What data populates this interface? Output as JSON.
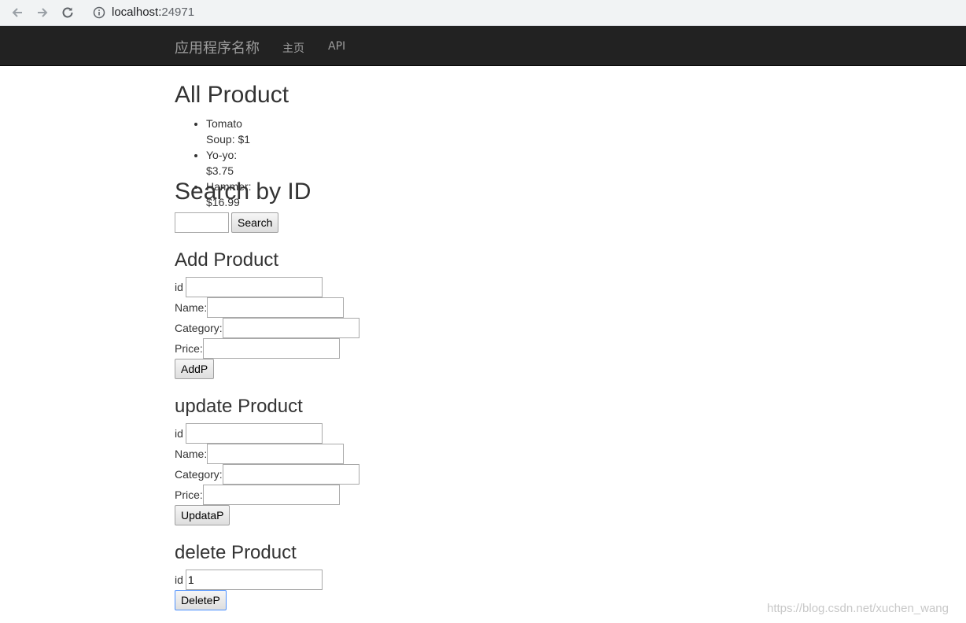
{
  "browser": {
    "url_host": "localhost:",
    "url_port": "24971"
  },
  "navbar": {
    "brand": "应用程序名称",
    "links": [
      "主页",
      "API"
    ],
    "background": "#222222"
  },
  "all_products": {
    "title": "All Product",
    "items": [
      "Tomato Soup: $1",
      "Yo-yo: $3.75",
      "Hammer: $16.99"
    ]
  },
  "search": {
    "title": "Search by ID",
    "input_value": "",
    "button": "Search"
  },
  "add_product": {
    "title": "Add Product",
    "labels": {
      "id": "id",
      "name": "Name:",
      "category": "Category:",
      "price": "Price:"
    },
    "button": "AddP"
  },
  "update_product": {
    "title": "update Product",
    "labels": {
      "id": "id",
      "name": "Name:",
      "category": "Category:",
      "price": "Price:"
    },
    "button": "UpdataP"
  },
  "delete_product": {
    "title": "delete Product",
    "label_id": "id",
    "id_value": "1",
    "button": "DeleteP"
  },
  "watermark": "https://blog.csdn.net/xuchen_wang"
}
